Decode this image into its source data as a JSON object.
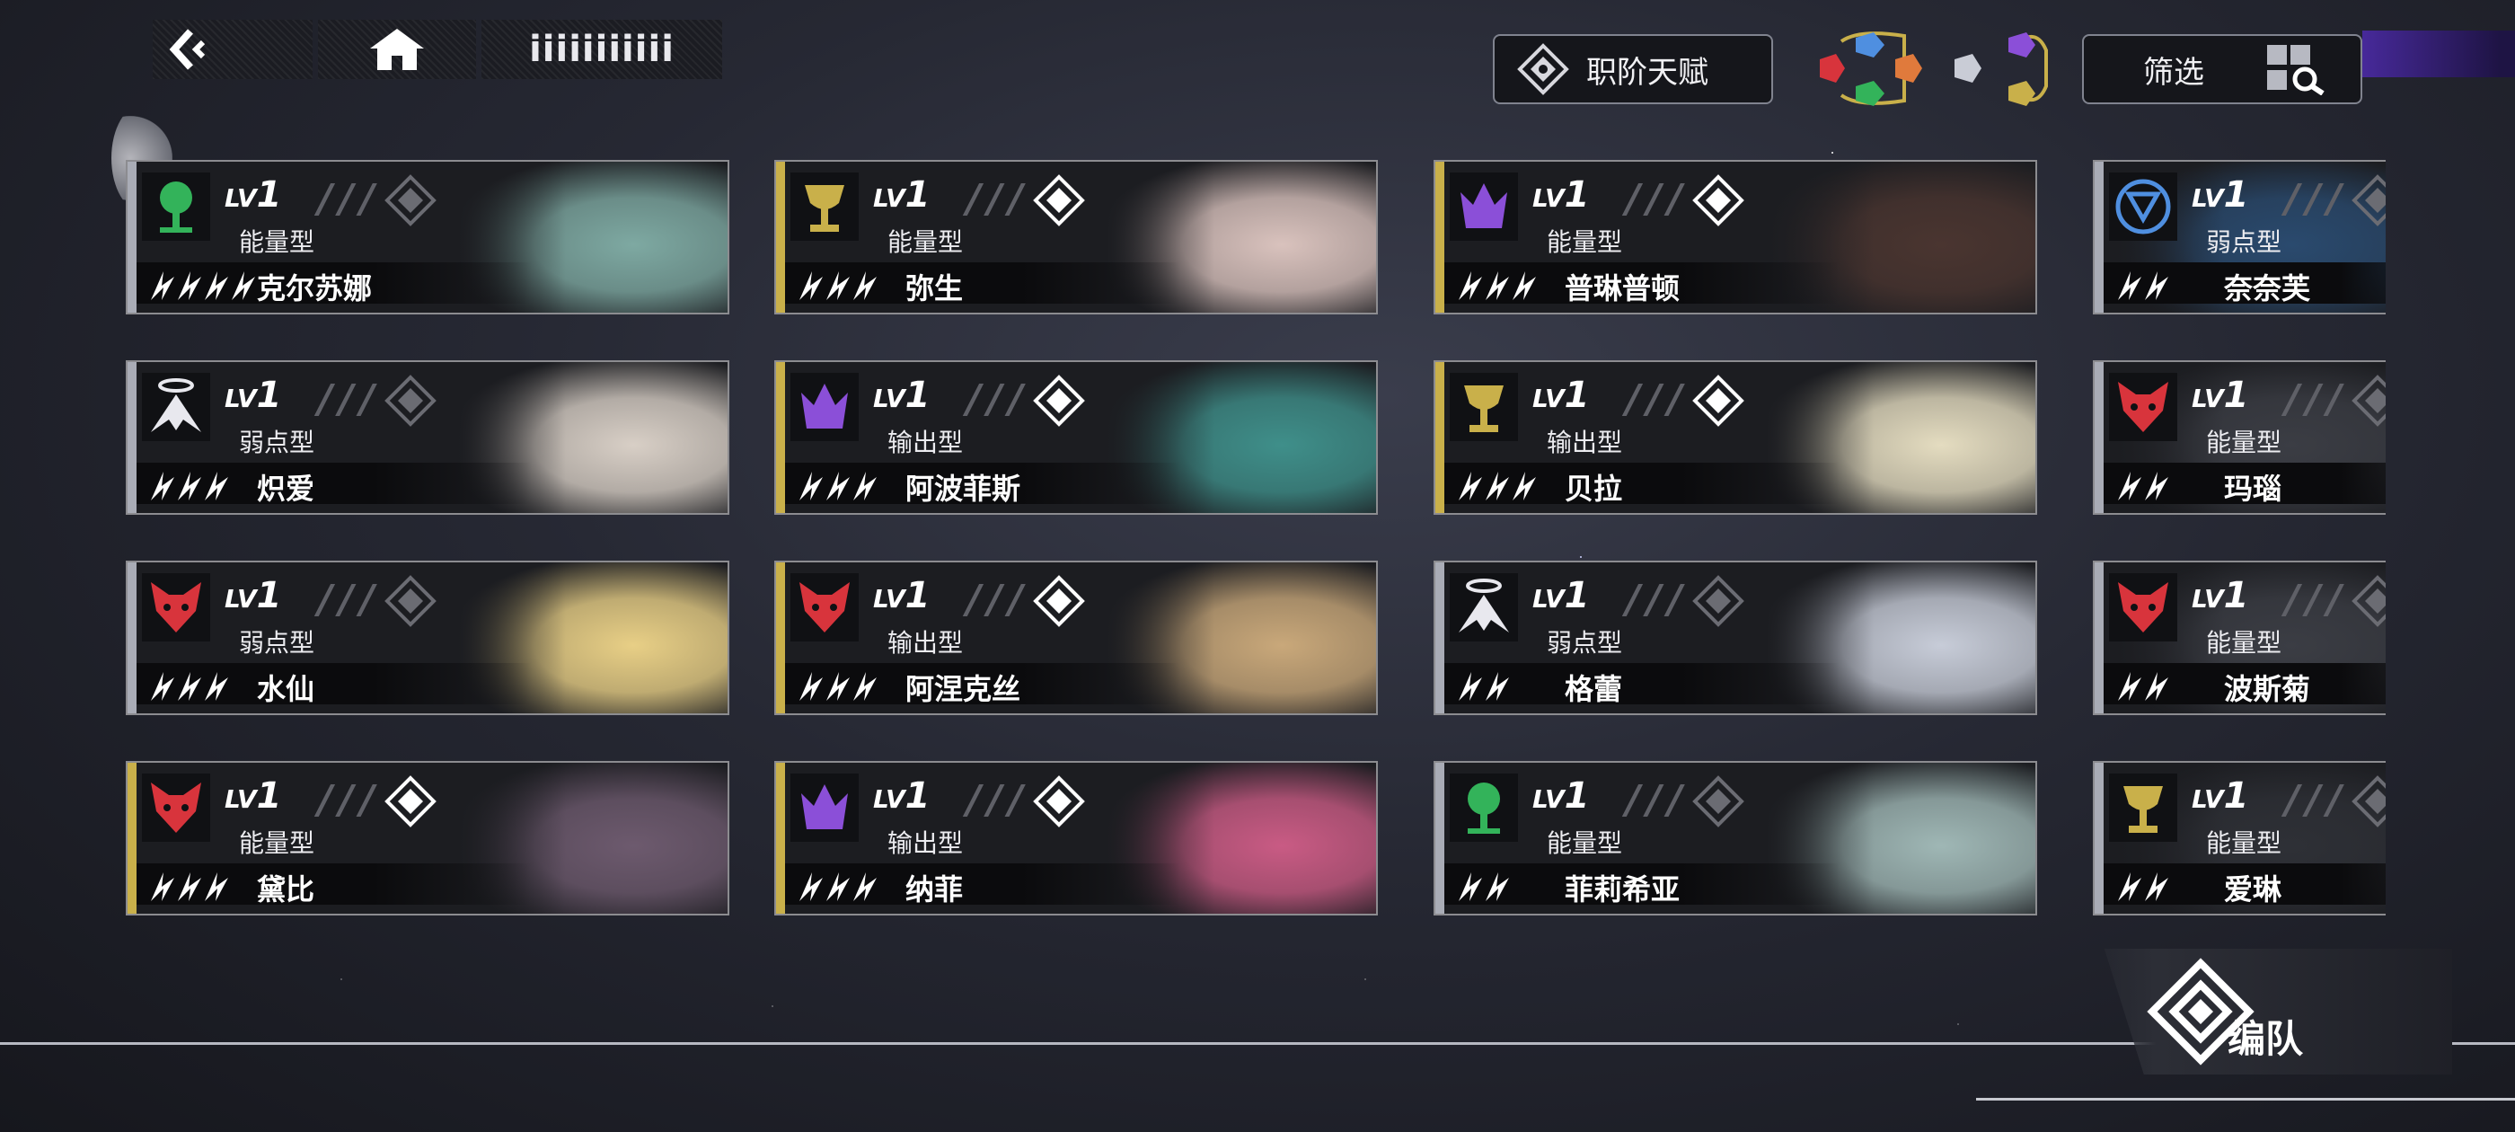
{
  "nav": {
    "list_label": "iiiiiiiiiii"
  },
  "buttons": {
    "talent_label": "职阶天赋",
    "filter_label": "筛选",
    "team_label": "编队"
  },
  "colors": {
    "gold": "#c9b04a",
    "silver": "#b9bcc6",
    "purple": "#8b4fd8",
    "red": "#d8343c",
    "green": "#33b35a",
    "blue": "#4f8fe0"
  },
  "cards": [
    {
      "name": "克尔苏娜",
      "type": "能量型",
      "level": "1",
      "lv": "LV",
      "rarity": "4",
      "element": "green",
      "frame": "silver",
      "icon": "tree-icon",
      "art": "#7ea9a2"
    },
    {
      "name": "弥生",
      "type": "能量型",
      "level": "1",
      "lv": "LV",
      "rarity": "3",
      "element": "gold",
      "frame": "gold",
      "icon": "chalice-icon",
      "art": "#d9c2bd"
    },
    {
      "name": "普琳普顿",
      "type": "能量型",
      "level": "1",
      "lv": "LV",
      "rarity": "3",
      "element": "purple",
      "frame": "gold",
      "icon": "crown-icon",
      "art": "#4a3530"
    },
    {
      "name": "奈奈芙",
      "type": "弱点型",
      "level": "1",
      "lv": "LV",
      "rarity": "2",
      "element": "blue",
      "frame": "silver",
      "icon": "shield-icon",
      "art": "#2a4a6e"
    },
    {
      "name": "炽爱",
      "type": "弱点型",
      "level": "1",
      "lv": "LV",
      "rarity": "3",
      "element": "white",
      "frame": "silver",
      "icon": "wings-icon",
      "art": "#d8cfc6"
    },
    {
      "name": "阿波菲斯",
      "type": "输出型",
      "level": "1",
      "lv": "LV",
      "rarity": "3",
      "element": "purple",
      "frame": "gold",
      "icon": "crown-icon",
      "art": "#3f8f8a"
    },
    {
      "name": "贝拉",
      "type": "输出型",
      "level": "1",
      "lv": "LV",
      "rarity": "3",
      "element": "gold",
      "frame": "gold",
      "icon": "chalice-icon",
      "art": "#e4dcc0"
    },
    {
      "name": "玛瑙",
      "type": "能量型",
      "level": "1",
      "lv": "LV",
      "rarity": "2",
      "element": "red",
      "frame": "silver",
      "icon": "wolf-icon",
      "art": "#3b3d44"
    },
    {
      "name": "水仙",
      "type": "弱点型",
      "level": "1",
      "lv": "LV",
      "rarity": "3",
      "element": "red",
      "frame": "silver",
      "icon": "wolf-icon",
      "art": "#e8cf86"
    },
    {
      "name": "阿涅克丝",
      "type": "输出型",
      "level": "1",
      "lv": "LV",
      "rarity": "3",
      "element": "red",
      "frame": "gold",
      "icon": "wolf-icon",
      "art": "#c9a87a"
    },
    {
      "name": "格蕾",
      "type": "弱点型",
      "level": "1",
      "lv": "LV",
      "rarity": "2",
      "element": "white",
      "frame": "silver",
      "icon": "wings-icon",
      "art": "#c7ccd8"
    },
    {
      "name": "波斯菊",
      "type": "能量型",
      "level": "1",
      "lv": "LV",
      "rarity": "2",
      "element": "red",
      "frame": "silver",
      "icon": "wolf-icon",
      "art": "#3b3d44"
    },
    {
      "name": "黛比",
      "type": "能量型",
      "level": "1",
      "lv": "LV",
      "rarity": "3",
      "element": "red",
      "frame": "gold",
      "icon": "wolf-icon",
      "art": "#6d5a6e"
    },
    {
      "name": "纳菲",
      "type": "输出型",
      "level": "1",
      "lv": "LV",
      "rarity": "3",
      "element": "purple",
      "frame": "gold",
      "icon": "crown-icon",
      "art": "#c95b84"
    },
    {
      "name": "菲莉希亚",
      "type": "能量型",
      "level": "1",
      "lv": "LV",
      "rarity": "2",
      "element": "green",
      "frame": "silver",
      "icon": "tree-icon",
      "art": "#9fb7b5"
    },
    {
      "name": "爱琳",
      "type": "能量型",
      "level": "1",
      "lv": "LV",
      "rarity": "2",
      "element": "gold",
      "frame": "silver",
      "icon": "chalice-icon",
      "art": "#2e3036"
    }
  ]
}
